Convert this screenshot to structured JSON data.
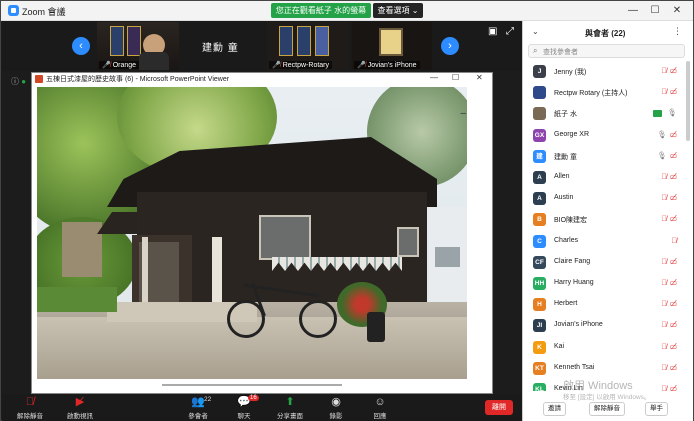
{
  "window": {
    "title": "Zoom 會議",
    "share_banner": "您正在觀看紙子 水的螢幕",
    "view_options": "查看選項 ⌄",
    "controls": [
      "—",
      "☐",
      "✕"
    ]
  },
  "strip": {
    "prev_icon": "chevron-left",
    "next_icon": "chevron-right",
    "center_name": "建勳 童",
    "thumbs": [
      {
        "name": "Orange"
      },
      {
        "name": "Rectpw-Rotary"
      },
      {
        "name": "Jovian's iPhone"
      }
    ]
  },
  "ppt": {
    "title": "五棟日式漆屋的歷史故事 (6) - Microsoft PowerPoint Viewer",
    "controls": [
      "—",
      "☐",
      "✕"
    ],
    "slide_marker": "–"
  },
  "toolbar": {
    "items": [
      {
        "label": "解除靜音",
        "icon": "mic-off"
      },
      {
        "label": "啟動視訊",
        "icon": "video-off"
      },
      {
        "label": "參會者",
        "icon": "participants",
        "count": "22"
      },
      {
        "label": "聊天",
        "icon": "chat",
        "badge": "16"
      },
      {
        "label": "分享畫面",
        "icon": "share"
      },
      {
        "label": "錄影",
        "icon": "record"
      },
      {
        "label": "回應",
        "icon": "reactions"
      }
    ],
    "end_label": "離開"
  },
  "panel": {
    "title": "與會者 (22)",
    "search_placeholder": "查找參會者",
    "participants": [
      {
        "initial": "J",
        "name": "Jenny (我)",
        "color": "#3a3f4a",
        "mic": "muted",
        "video": "off"
      },
      {
        "initial": "",
        "name": "Rectpw Rotary (主持人)",
        "color": "#2e4a8a",
        "mic": "muted",
        "video": "off"
      },
      {
        "initial": "",
        "name": "紙子 水",
        "color": "#7a6a55",
        "mic": "on",
        "video": "on"
      },
      {
        "initial": "GX",
        "name": "George XR",
        "color": "#8e44ad",
        "mic": "on",
        "video": "off"
      },
      {
        "initial": "建",
        "name": "建勳 童",
        "color": "#2d8cff",
        "mic": "on",
        "video": "off"
      },
      {
        "initial": "A",
        "name": "Allen",
        "color": "#2c3e50",
        "mic": "muted",
        "video": "off"
      },
      {
        "initial": "A",
        "name": "Austin",
        "color": "#2c3e50",
        "mic": "muted",
        "video": "off"
      },
      {
        "initial": "B",
        "name": "BIO陳建宏",
        "color": "#e67e22",
        "mic": "muted",
        "video": "off"
      },
      {
        "initial": "C",
        "name": "Charles",
        "color": "#2d8cff",
        "mic": "muted",
        "video": ""
      },
      {
        "initial": "CF",
        "name": "Claire Fang",
        "color": "#34495e",
        "mic": "muted",
        "video": "off"
      },
      {
        "initial": "HH",
        "name": "Harry Huang",
        "color": "#27ae60",
        "mic": "muted",
        "video": "off"
      },
      {
        "initial": "H",
        "name": "Herbert",
        "color": "#e67e22",
        "mic": "muted",
        "video": "off"
      },
      {
        "initial": "JI",
        "name": "Jovian's iPhone",
        "color": "#2c3e50",
        "mic": "muted",
        "video": "off"
      },
      {
        "initial": "K",
        "name": "Kai",
        "color": "#f39c12",
        "mic": "muted",
        "video": "off"
      },
      {
        "initial": "KT",
        "name": "Kenneth Tsai",
        "color": "#e67e22",
        "mic": "muted",
        "video": "off"
      },
      {
        "initial": "KL",
        "name": "Kevin Lin",
        "color": "#27ae60",
        "mic": "muted",
        "video": "off"
      }
    ],
    "footer": [
      "邀請",
      "解除靜音",
      "舉手"
    ]
  },
  "watermark": {
    "line1": "啟用 Windows",
    "line2": "移至 [設定] 以啟用 Windows。"
  }
}
